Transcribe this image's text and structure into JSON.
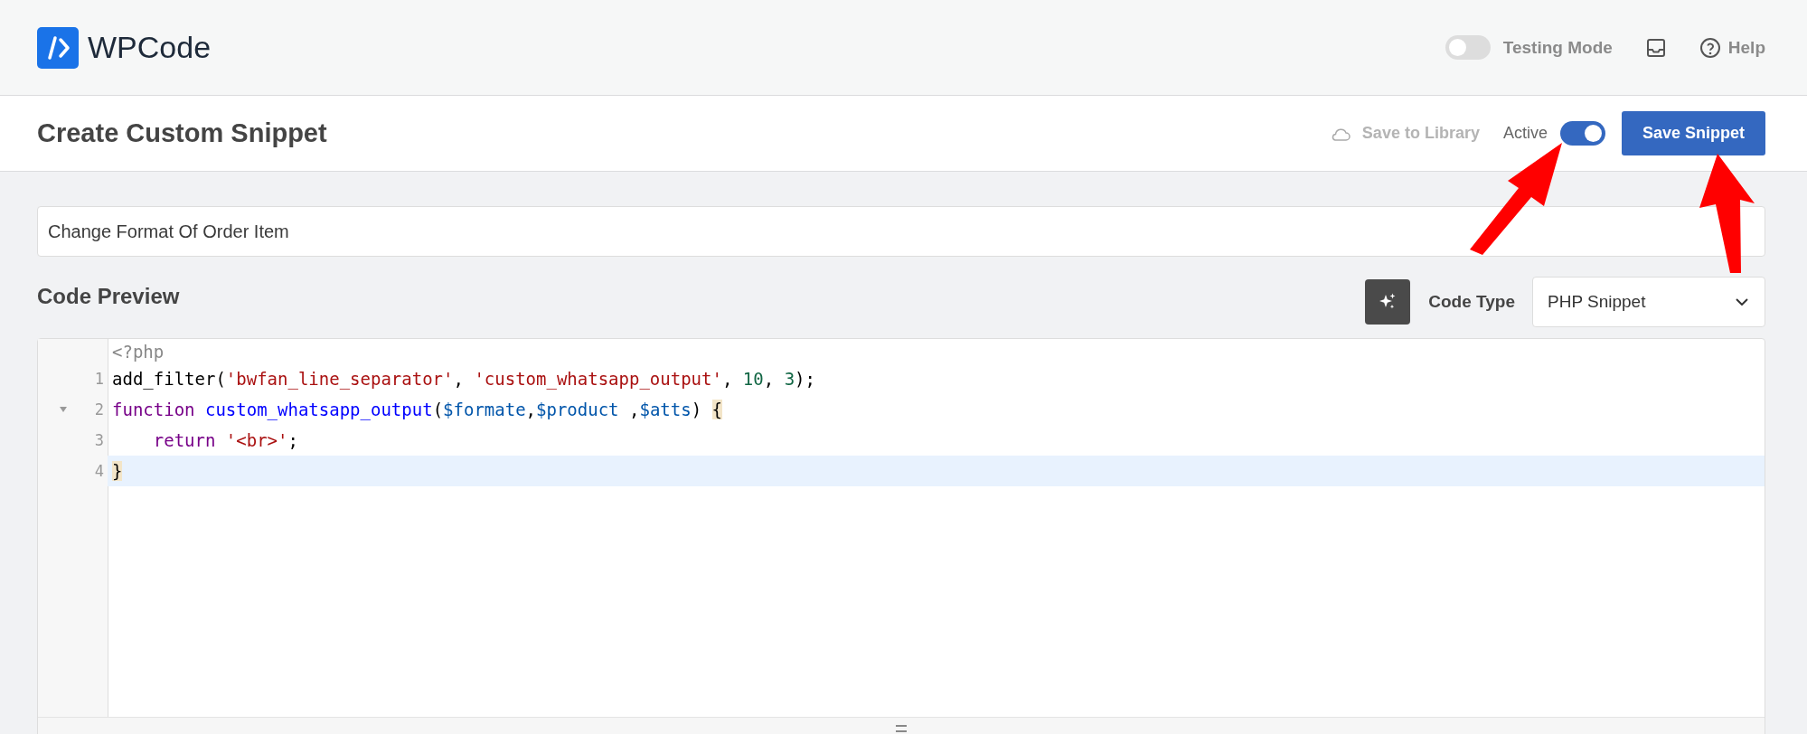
{
  "header": {
    "logo": "**WP**Code",
    "testing_mode": {
      "label": "Testing Mode",
      "on": false
    },
    "help": "Help"
  },
  "toolbar": {
    "title": "Create Custom Snippet",
    "save_to_library": {
      "label": "Save to Library",
      "disabled": true
    },
    "active": {
      "label": "Active",
      "on": true
    },
    "save_button": "Save Snippet"
  },
  "snippet_title": {
    "value": "Change Format Of Order Item"
  },
  "code_preview": {
    "heading": "Code Preview",
    "code_type": {
      "label": "Code Type",
      "value": "PHP Snippet"
    }
  },
  "editor": {
    "lines": [
      {
        "fold": false,
        "active": false,
        "tokens": [
          {
            "kind": "meta",
            "text": "<?php"
          }
        ]
      },
      {
        "number": "1",
        "fold": false,
        "active": false,
        "tokens": [
          {
            "kind": "plain",
            "text": "add_filter("
          },
          {
            "kind": "string",
            "text": "'bwfan_line_separator'"
          },
          {
            "kind": "plain",
            "text": ", "
          },
          {
            "kind": "string",
            "text": "'custom_whatsapp_output'"
          },
          {
            "kind": "plain",
            "text": ", "
          },
          {
            "kind": "number",
            "text": "10"
          },
          {
            "kind": "plain",
            "text": ", "
          },
          {
            "kind": "number",
            "text": "3"
          },
          {
            "kind": "plain",
            "text": ");"
          }
        ]
      },
      {
        "number": "2",
        "fold": true,
        "active": false,
        "tokens": [
          {
            "kind": "keyword",
            "text": "function"
          },
          {
            "kind": "def",
            "text": " custom_whatsapp_output"
          },
          {
            "kind": "plain",
            "text": "("
          },
          {
            "kind": "variable",
            "text": "$formate"
          },
          {
            "kind": "plain",
            "text": ","
          },
          {
            "kind": "variable",
            "text": "$product"
          },
          {
            "kind": "plain",
            "text": " ,"
          },
          {
            "kind": "variable",
            "text": "$atts"
          },
          {
            "kind": "plain",
            "text": ") "
          },
          {
            "kind": "bracket",
            "text": "{"
          }
        ]
      },
      {
        "number": "3",
        "fold": false,
        "active": false,
        "tokens": [
          {
            "kind": "keyword",
            "text": "    return"
          },
          {
            "kind": "string",
            "text": " '<br>'"
          },
          {
            "kind": "plain",
            "text": ";"
          }
        ]
      },
      {
        "number": "4",
        "fold": false,
        "active": true,
        "tokens": [
          {
            "kind": "bracket",
            "text": "}"
          }
        ]
      }
    ]
  }
}
